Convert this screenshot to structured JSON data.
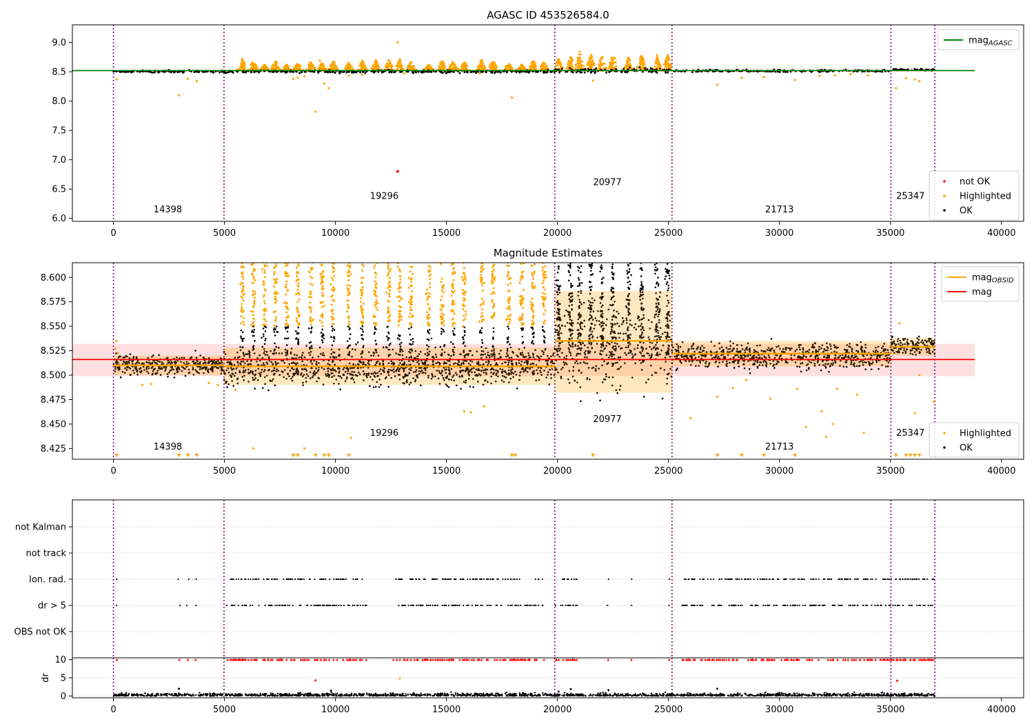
{
  "chart_data": [
    {
      "panel": "agasc",
      "type": "scatter",
      "title": "AGASC ID 453526584.0",
      "xlim": [
        -1850,
        41000
      ],
      "ylim": [
        5.95,
        9.3
      ],
      "yticks": [
        "6.0",
        "6.5",
        "7.0",
        "7.5",
        "8.0",
        "8.5",
        "9.0"
      ],
      "ytick_values": [
        6.0,
        6.5,
        7.0,
        7.5,
        8.0,
        8.5,
        9.0
      ],
      "xticks": [
        "0",
        "5000",
        "10000",
        "15000",
        "20000",
        "25000",
        "30000",
        "35000",
        "40000"
      ],
      "xtick_values": [
        0,
        5000,
        10000,
        15000,
        20000,
        25000,
        30000,
        35000,
        40000
      ],
      "mag_agasc": 8.52,
      "line_x_range": [
        -1850,
        38800
      ],
      "obsid_boundaries": [
        0,
        4980,
        19880,
        25160,
        35020,
        37000
      ],
      "obsid_labels": [
        {
          "text": "14398",
          "x": 2450,
          "y": 6.1
        },
        {
          "text": "19296",
          "x": 12200,
          "y": 6.33
        },
        {
          "text": "20977",
          "x": 22250,
          "y": 6.57
        },
        {
          "text": "21713",
          "x": 30000,
          "y": 6.1
        },
        {
          "text": "25347",
          "x": 35900,
          "y": 6.33
        }
      ],
      "ok_segments": [
        {
          "x0": 0,
          "x1": 4980,
          "center": 8.505,
          "spread": 0.018
        },
        {
          "x0": 4980,
          "x1": 19880,
          "center": 8.505,
          "spread": 0.025
        },
        {
          "x0": 19880,
          "x1": 25160,
          "center": 8.52,
          "spread": 0.04
        },
        {
          "x0": 25160,
          "x1": 35020,
          "center": 8.515,
          "spread": 0.02
        },
        {
          "x0": 35020,
          "x1": 37000,
          "center": 8.535,
          "spread": 0.015
        }
      ],
      "highlighted_points": [
        [
          150,
          8.37
        ],
        [
          2950,
          8.1
        ],
        [
          3350,
          8.38
        ],
        [
          3750,
          8.34
        ],
        [
          8100,
          8.38
        ],
        [
          8300,
          8.4
        ],
        [
          8600,
          8.42
        ],
        [
          9100,
          7.82
        ],
        [
          9300,
          8.69
        ],
        [
          9500,
          8.3
        ],
        [
          9700,
          8.22
        ],
        [
          10600,
          8.43
        ],
        [
          11200,
          8.45
        ],
        [
          12800,
          9.0
        ],
        [
          13100,
          8.47
        ],
        [
          16500,
          8.47
        ],
        [
          17950,
          8.06
        ],
        [
          21600,
          8.35
        ],
        [
          27200,
          8.28
        ],
        [
          28300,
          8.4
        ],
        [
          29300,
          8.41
        ],
        [
          30700,
          8.36
        ],
        [
          31800,
          8.43
        ],
        [
          32500,
          8.44
        ],
        [
          33200,
          8.46
        ],
        [
          34000,
          8.44
        ],
        [
          35250,
          8.22
        ],
        [
          35700,
          8.39
        ],
        [
          36100,
          8.37
        ],
        [
          36300,
          8.34
        ]
      ],
      "highlighted_peaks": [
        {
          "x": 5800,
          "top": 8.73
        },
        {
          "x": 6300,
          "top": 8.7
        },
        {
          "x": 6800,
          "top": 8.63
        },
        {
          "x": 7300,
          "top": 8.71
        },
        {
          "x": 7800,
          "top": 8.63
        },
        {
          "x": 8300,
          "top": 8.67
        },
        {
          "x": 8900,
          "top": 8.69
        },
        {
          "x": 9400,
          "top": 8.66
        },
        {
          "x": 9900,
          "top": 8.71
        },
        {
          "x": 10600,
          "top": 8.66
        },
        {
          "x": 11200,
          "top": 8.7
        },
        {
          "x": 11800,
          "top": 8.72
        },
        {
          "x": 12400,
          "top": 8.71
        },
        {
          "x": 12900,
          "top": 8.72
        },
        {
          "x": 13400,
          "top": 8.68
        },
        {
          "x": 14200,
          "top": 8.63
        },
        {
          "x": 14800,
          "top": 8.71
        },
        {
          "x": 15300,
          "top": 8.69
        },
        {
          "x": 15800,
          "top": 8.68
        },
        {
          "x": 16600,
          "top": 8.73
        },
        {
          "x": 17100,
          "top": 8.71
        },
        {
          "x": 17800,
          "top": 8.66
        },
        {
          "x": 18400,
          "top": 8.63
        },
        {
          "x": 18900,
          "top": 8.71
        },
        {
          "x": 19400,
          "top": 8.69
        },
        {
          "x": 20050,
          "top": 8.74
        },
        {
          "x": 20600,
          "top": 8.79
        },
        {
          "x": 21000,
          "top": 8.86
        },
        {
          "x": 21500,
          "top": 8.82
        },
        {
          "x": 22000,
          "top": 8.79
        },
        {
          "x": 22500,
          "top": 8.85
        },
        {
          "x": 23200,
          "top": 8.77
        },
        {
          "x": 23800,
          "top": 8.82
        },
        {
          "x": 24500,
          "top": 8.8
        },
        {
          "x": 24950,
          "top": 8.82
        }
      ],
      "not_ok_points": [
        [
          12800,
          6.8
        ]
      ],
      "legend_upper": [
        {
          "label": "mag",
          "sub": "AGASC",
          "color": "#008000",
          "marker": "line"
        }
      ],
      "legend_lower": [
        {
          "label": "not OK",
          "color": "#ff0000",
          "marker": "dot"
        },
        {
          "label": "Highlighted",
          "color": "#ffa500",
          "marker": "dot"
        },
        {
          "label": "OK",
          "color": "#000000",
          "marker": "dot"
        }
      ]
    },
    {
      "panel": "estimates",
      "type": "scatter",
      "title": "Magnitude Estimates",
      "xlim": [
        -1850,
        41000
      ],
      "ylim": [
        8.414,
        8.615
      ],
      "yticks": [
        "8.425",
        "8.450",
        "8.475",
        "8.500",
        "8.525",
        "8.550",
        "8.575",
        "8.600"
      ],
      "ytick_values": [
        8.425,
        8.45,
        8.475,
        8.5,
        8.525,
        8.55,
        8.575,
        8.6
      ],
      "xticks": [
        "0",
        "5000",
        "10000",
        "15000",
        "20000",
        "25000",
        "30000",
        "35000",
        "40000"
      ],
      "xtick_values": [
        0,
        5000,
        10000,
        15000,
        20000,
        25000,
        30000,
        35000,
        40000
      ],
      "mag": 8.516,
      "mag_band": [
        8.499,
        8.532
      ],
      "mag_x_range": [
        -1850,
        38800
      ],
      "obsid_boundaries": [
        0,
        4980,
        19880,
        25160,
        35020,
        37000
      ],
      "obsid_mags": [
        {
          "x0": 0,
          "x1": 4980,
          "mag": 8.51,
          "lo": 8.5,
          "hi": 8.52
        },
        {
          "x0": 4980,
          "x1": 19880,
          "mag": 8.509,
          "lo": 8.49,
          "hi": 8.528
        },
        {
          "x0": 19880,
          "x1": 25160,
          "mag": 8.535,
          "lo": 8.482,
          "hi": 8.586
        },
        {
          "x0": 25160,
          "x1": 35020,
          "mag": 8.522,
          "lo": 8.509,
          "hi": 8.535
        },
        {
          "x0": 35020,
          "x1": 37000,
          "mag": 8.529,
          "lo": 8.52,
          "hi": 8.538
        }
      ],
      "obsid_labels": [
        {
          "text": "14398",
          "x": 2450,
          "y": 8.424
        },
        {
          "text": "19296",
          "x": 12200,
          "y": 8.438
        },
        {
          "text": "20977",
          "x": 22250,
          "y": 8.452
        },
        {
          "text": "21713",
          "x": 30000,
          "y": 8.424
        },
        {
          "text": "25347",
          "x": 35900,
          "y": 8.438
        }
      ],
      "ok_segments": [
        {
          "x0": 0,
          "x1": 4980,
          "center": 8.51,
          "spread": 0.011
        },
        {
          "x0": 4980,
          "x1": 19880,
          "center": 8.508,
          "spread": 0.02
        },
        {
          "x0": 19880,
          "x1": 25160,
          "center": 8.53,
          "spread": 0.05
        },
        {
          "x0": 25160,
          "x1": 35020,
          "center": 8.52,
          "spread": 0.014
        },
        {
          "x0": 35020,
          "x1": 37000,
          "center": 8.53,
          "spread": 0.01
        }
      ],
      "highlighted_spikes": [
        5800,
        6300,
        6800,
        7300,
        7800,
        8300,
        8900,
        9400,
        9900,
        10600,
        11200,
        11800,
        12400,
        12900,
        13400,
        14200,
        14800,
        15300,
        15800,
        16600,
        17100,
        17800,
        18400,
        18900,
        19400
      ],
      "black_spikes": [
        20050,
        20600,
        21000,
        21500,
        22000,
        22500,
        23200,
        23800,
        24500,
        24950
      ],
      "highlighted_points": [
        [
          80,
          8.527
        ],
        [
          130,
          8.535
        ],
        [
          200,
          8.523
        ],
        [
          1300,
          8.49
        ],
        [
          1700,
          8.491
        ],
        [
          4300,
          8.492
        ],
        [
          4700,
          8.49
        ],
        [
          5500,
          8.485
        ],
        [
          15800,
          8.463
        ],
        [
          16100,
          8.462
        ],
        [
          16700,
          8.468
        ],
        [
          10700,
          8.436
        ],
        [
          6300,
          8.425
        ],
        [
          8600,
          8.425
        ],
        [
          26000,
          8.456
        ],
        [
          27200,
          8.478
        ],
        [
          27900,
          8.487
        ],
        [
          28500,
          8.495
        ],
        [
          29600,
          8.476
        ],
        [
          30800,
          8.486
        ],
        [
          31200,
          8.447
        ],
        [
          31900,
          8.463
        ],
        [
          32400,
          8.45
        ],
        [
          32100,
          8.437
        ],
        [
          32600,
          8.486
        ],
        [
          33500,
          8.48
        ],
        [
          33800,
          8.441
        ],
        [
          35400,
          8.553
        ],
        [
          36300,
          8.5
        ],
        [
          36100,
          8.461
        ],
        [
          36950,
          8.473
        ]
      ],
      "down_markers": [
        150,
        2950,
        3350,
        3750,
        8100,
        8300,
        9100,
        9500,
        9700,
        10600,
        17950,
        18100,
        21600,
        27200,
        28300,
        29300,
        30700,
        35250,
        35700,
        35900,
        36100,
        36300
      ],
      "legend_upper": [
        {
          "label": "mag",
          "sub": "OBSID",
          "color": "#ffa500",
          "marker": "line"
        },
        {
          "label": "mag",
          "sub": "",
          "color": "#ff0000",
          "marker": "line"
        }
      ],
      "legend_lower": [
        {
          "label": "Highlighted",
          "color": "#ffa500",
          "marker": "dot"
        },
        {
          "label": "OK",
          "color": "#000000",
          "marker": "dot"
        }
      ]
    },
    {
      "panel": "flags",
      "type": "scatter",
      "xlim": [
        -1850,
        41000
      ],
      "ylabels": [
        "not Kalman",
        "not track",
        "Ion. rad.",
        "dr > 5",
        "OBS not OK"
      ],
      "obsid_boundaries": [
        0,
        4980,
        19880,
        25160,
        35020,
        37000
      ],
      "flagged_clusters": [
        [
          130,
          160
        ],
        [
          2900,
          3000
        ],
        [
          3300,
          3400
        ],
        [
          3700,
          3800
        ],
        [
          5000,
          11400
        ],
        [
          12600,
          19400
        ],
        [
          19900,
          20900
        ],
        [
          22200,
          22300
        ],
        [
          23250,
          23350
        ],
        [
          24950,
          25050
        ],
        [
          25600,
          36950
        ]
      ],
      "flag_rows": [
        "Ion. rad.",
        "dr > 5"
      ]
    },
    {
      "panel": "dr",
      "type": "scatter",
      "ylabel": "dr",
      "xlim": [
        -1850,
        41000
      ],
      "ylim": [
        -0.5,
        10.5
      ],
      "yticks": [
        "0",
        "5",
        "10"
      ],
      "ytick_values": [
        0,
        5,
        10
      ],
      "xticks": [
        "0",
        "5000",
        "10000",
        "15000",
        "20000",
        "25000",
        "30000",
        "35000",
        "40000"
      ],
      "xtick_values": [
        0,
        5000,
        10000,
        15000,
        20000,
        25000,
        30000,
        35000,
        40000
      ],
      "obsid_boundaries": [
        0,
        4980,
        19880,
        25160,
        35020,
        37000
      ],
      "capped_value": 10,
      "capped_clusters": [
        [
          130,
          160
        ],
        [
          2900,
          3000
        ],
        [
          3300,
          3400
        ],
        [
          3700,
          3800
        ],
        [
          5000,
          11400
        ],
        [
          12600,
          19400
        ],
        [
          19900,
          20900
        ],
        [
          22200,
          22300
        ],
        [
          23250,
          23350
        ],
        [
          24950,
          25050
        ],
        [
          25600,
          36950
        ]
      ],
      "outliers": [
        [
          2950,
          2.0
        ],
        [
          9100,
          4.3
        ],
        [
          9800,
          1.5
        ],
        [
          12900,
          4.8
        ],
        [
          20050,
          1.2
        ],
        [
          20600,
          1.9
        ],
        [
          22300,
          1.6
        ],
        [
          27200,
          2.0
        ],
        [
          35300,
          4.2
        ]
      ],
      "outlier_colors": [
        "#000000",
        "#ff0000",
        "#000000",
        "#ffa500",
        "#000000",
        "#000000",
        "#000000",
        "#000000",
        "#ff0000"
      ]
    }
  ]
}
